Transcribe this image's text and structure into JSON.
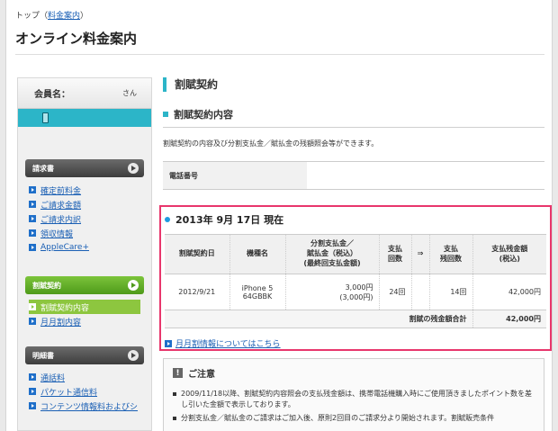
{
  "breadcrumb": {
    "top": "トップ",
    "open": "（",
    "link": "料金案内",
    "close": "）"
  },
  "page_title": "オンライン料金案内",
  "sidebar": {
    "member_label": "会員名：",
    "member_suffix": "さん",
    "sections": [
      {
        "title": "請求書",
        "items": [
          "確定前料金",
          "ご請求金額",
          "ご請求内訳",
          "領収情報",
          "AppleCare+"
        ]
      },
      {
        "title": "割賦契約",
        "items": [
          "割賦契約内容",
          "月月割内容"
        ],
        "active_index": 0
      },
      {
        "title": "明細書",
        "items": [
          "通話料",
          "パケット通信料",
          "コンテンツ情報料およびシ"
        ]
      }
    ]
  },
  "main": {
    "section_title": "割賦契約",
    "subsection_title": "割賦契約内容",
    "description": "割賦契約の内容及び分割支払金／賦払金の残額照会等ができます。",
    "phone_label": "電話番号",
    "as_of": "2013年 9月 17日 現在",
    "table": {
      "headers": [
        "割賦契約日",
        "機種名",
        "分割支払金／\n賦払金（税込）\n(最終回支払金額)",
        "支払\n回数",
        "⇒",
        "支払\n残回数",
        "支払残金額\n(税込)"
      ],
      "row": {
        "date": "2012/9/21",
        "model_line1": "iPhone 5",
        "model_line2": "64GBBK",
        "amount": "3,000円",
        "amount_final": "(3,000円)",
        "count": "24回",
        "remaining_count": "14回",
        "remaining_amount": "42,000円"
      },
      "total_label": "割賦の残金額合計",
      "total_value": "42,000円"
    },
    "info_link": "月月割情報についてはこちら",
    "notice": {
      "title": "ご注意",
      "items": [
        "2009/11/18以降、割賦契約内容照会の支払残金額は、携帯電話機購入時にご使用頂きましたポイント数を差し引いた金額で表示しております。",
        "分割支払金／賦払金のご請求はご加入後、原則2回目のご請求分より開始されます。割賦販売条件"
      ]
    }
  }
}
